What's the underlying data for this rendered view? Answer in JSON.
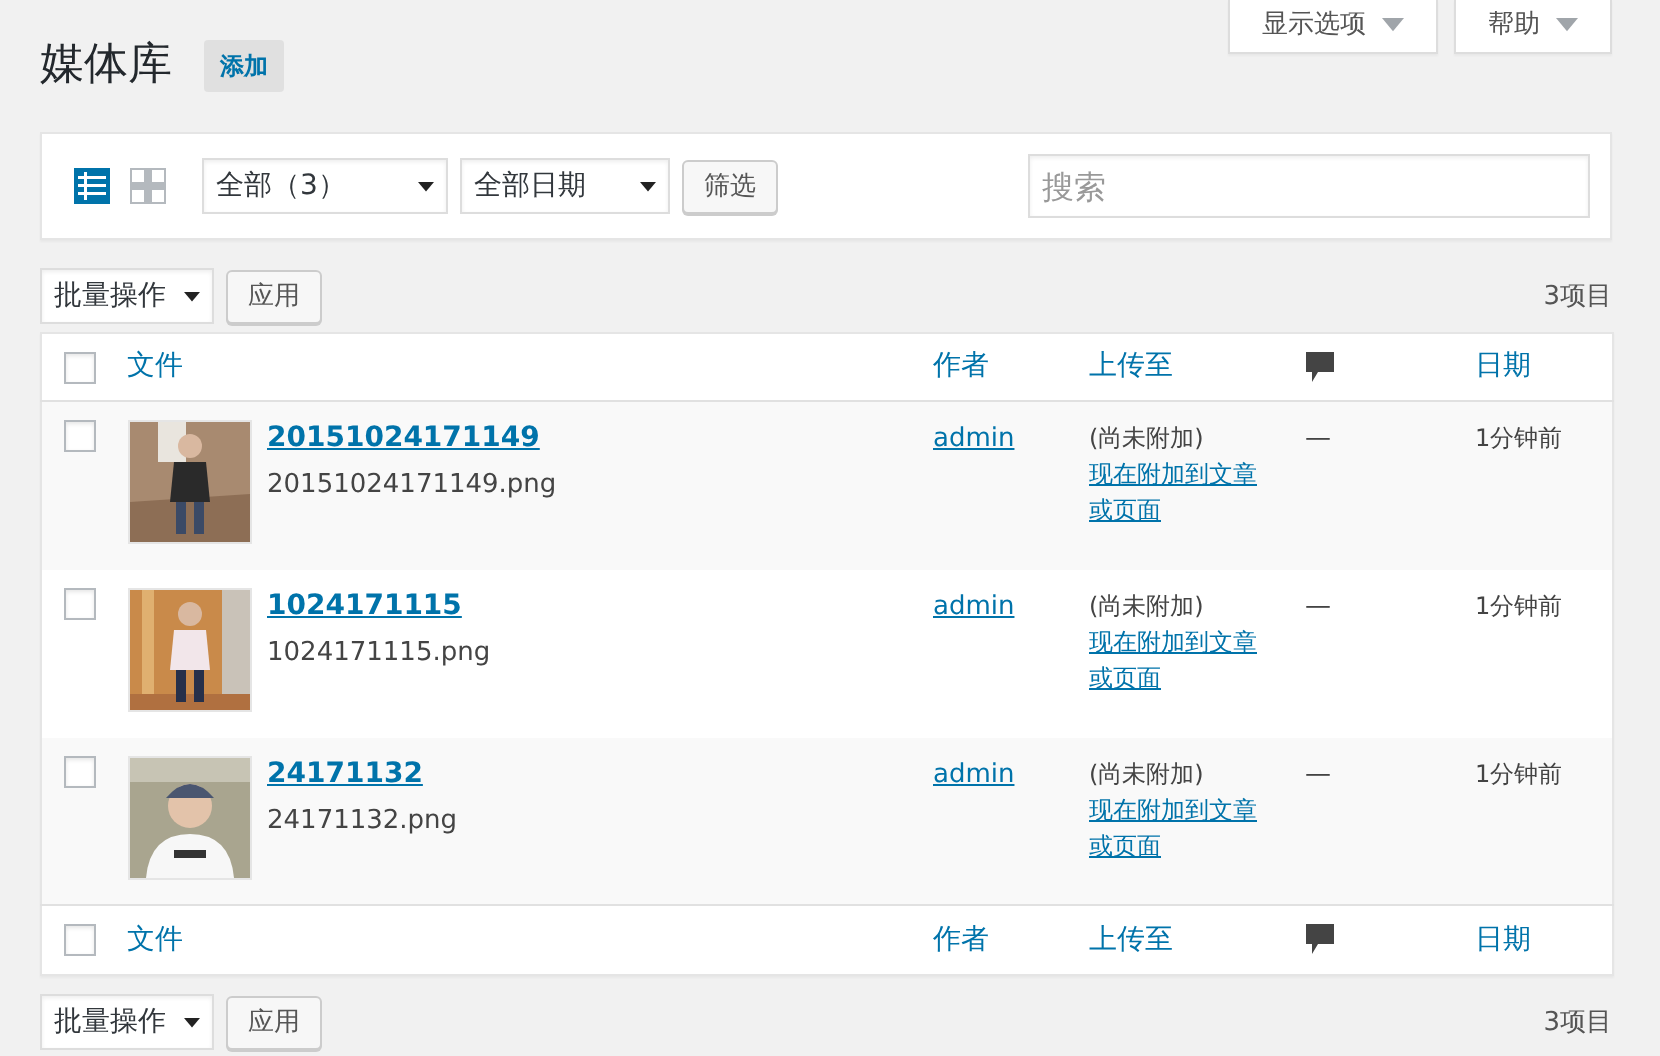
{
  "screen_tabs": [
    {
      "label": "显示选项"
    },
    {
      "label": "帮助"
    }
  ],
  "page": {
    "title": "媒体库",
    "add_button": "添加"
  },
  "filter_bar": {
    "views": [
      {
        "kind": "list",
        "selected": true
      },
      {
        "kind": "grid",
        "selected": false
      }
    ],
    "type_filter": "全部（3）",
    "date_filter": "全部日期",
    "filter_button": "筛选",
    "search": {
      "placeholder": "搜索"
    }
  },
  "top_nav": {
    "bulk_action": "批量操作",
    "apply_button": "应用",
    "count": "3项目"
  },
  "table": {
    "header_columns": [
      {
        "kind": "check",
        "checked": false
      },
      {
        "kind": "text",
        "label": "文件"
      },
      {
        "kind": "text",
        "label": "作者"
      },
      {
        "kind": "text",
        "label": "上传至"
      },
      {
        "kind": "comments"
      },
      {
        "kind": "text",
        "label": "日期"
      }
    ],
    "rows": [
      {
        "checked": false,
        "title": "20151024171149",
        "filename": "20151024171149.png",
        "author": "admin",
        "uploaded_to": "(尚未附加)",
        "attach_link": "现在附加到文章或页面",
        "comments": "—",
        "date": "1分钟前"
      },
      {
        "checked": false,
        "title": "1024171115",
        "filename": "1024171115.png",
        "author": "admin",
        "uploaded_to": "(尚未附加)",
        "attach_link": "现在附加到文章或页面",
        "comments": "—",
        "date": "1分钟前"
      },
      {
        "checked": false,
        "title": "24171132",
        "filename": "24171132.png",
        "author": "admin",
        "uploaded_to": "(尚未附加)",
        "attach_link": "现在附加到文章或页面",
        "comments": "—",
        "date": "1分钟前"
      }
    ],
    "footer_columns": [
      {
        "kind": "check",
        "checked": false
      },
      {
        "kind": "text",
        "label": "文件"
      },
      {
        "kind": "text",
        "label": "作者"
      },
      {
        "kind": "text",
        "label": "上传至"
      },
      {
        "kind": "comments"
      },
      {
        "kind": "text",
        "label": "日期"
      }
    ]
  },
  "bottom_nav": {
    "bulk_action": "批量操作",
    "apply_button": "应用",
    "count": "3项目"
  }
}
